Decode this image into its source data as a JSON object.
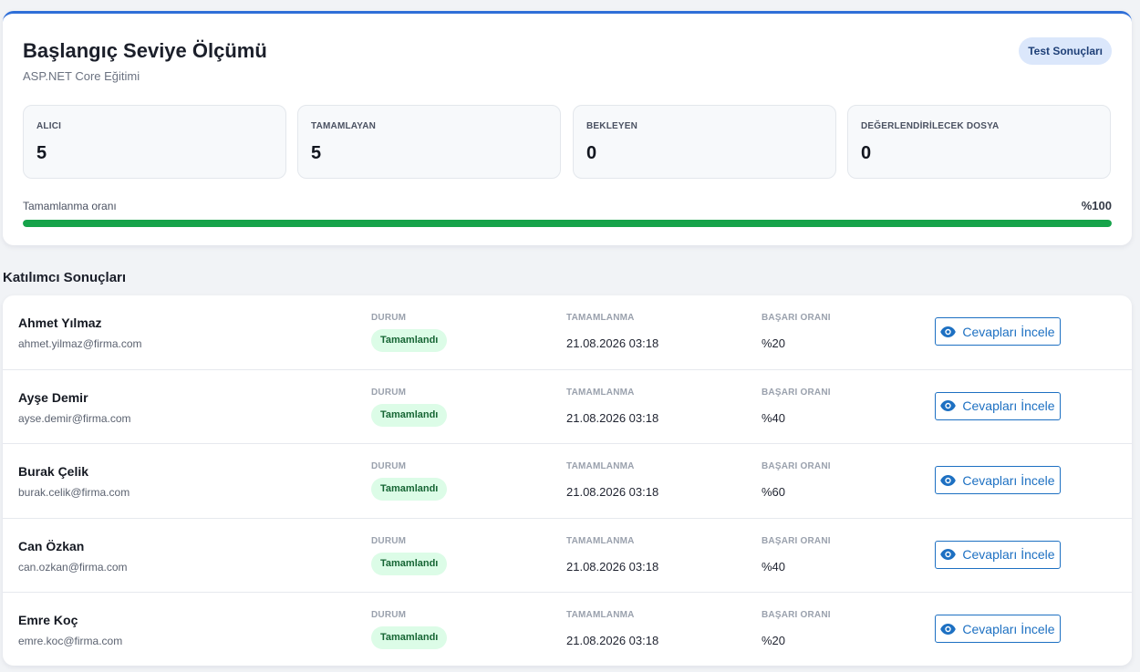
{
  "header": {
    "title": "Başlangıç Seviye Ölçümü",
    "subtitle": "ASP.NET Core Eğitimi",
    "badge_label": "Test Sonuçları"
  },
  "stats": [
    {
      "label": "ALICI",
      "value": "5"
    },
    {
      "label": "TAMAMLAYAN",
      "value": "5"
    },
    {
      "label": "BEKLEYEN",
      "value": "0"
    },
    {
      "label": "DEĞERLENDİRİLECEK DOSYA",
      "value": "0"
    }
  ],
  "progress": {
    "label": "Tamamlanma oranı",
    "value_text": "%100",
    "percent": 100
  },
  "results": {
    "section_title": "Katılımcı Sonuçları",
    "column_labels": {
      "status": "DURUM",
      "completion": "TAMAMLANMA",
      "success_rate": "BAŞARI ORANI"
    },
    "button_label": "Cevapları İncele",
    "rows": [
      {
        "name": "Ahmet Yılmaz",
        "email": "ahmet.yilmaz@firma.com",
        "status": "Tamamlandı",
        "completion": "21.08.2026 03:18",
        "success_rate": "%20"
      },
      {
        "name": "Ayşe Demir",
        "email": "ayse.demir@firma.com",
        "status": "Tamamlandı",
        "completion": "21.08.2026 03:18",
        "success_rate": "%40"
      },
      {
        "name": "Burak Çelik",
        "email": "burak.celik@firma.com",
        "status": "Tamamlandı",
        "completion": "21.08.2026 03:18",
        "success_rate": "%60"
      },
      {
        "name": "Can Özkan",
        "email": "can.ozkan@firma.com",
        "status": "Tamamlandı",
        "completion": "21.08.2026 03:18",
        "success_rate": "%40"
      },
      {
        "name": "Emre Koç",
        "email": "emre.koc@firma.com",
        "status": "Tamamlandı",
        "completion": "21.08.2026 03:18",
        "success_rate": "%20"
      }
    ]
  },
  "colors": {
    "accent": "#2f6fd8",
    "progress": "#16a34a",
    "status_bg": "#dcfce7",
    "status_text": "#166534",
    "button": "#1d70c2"
  },
  "icons": {
    "review_button": "eye-icon"
  }
}
